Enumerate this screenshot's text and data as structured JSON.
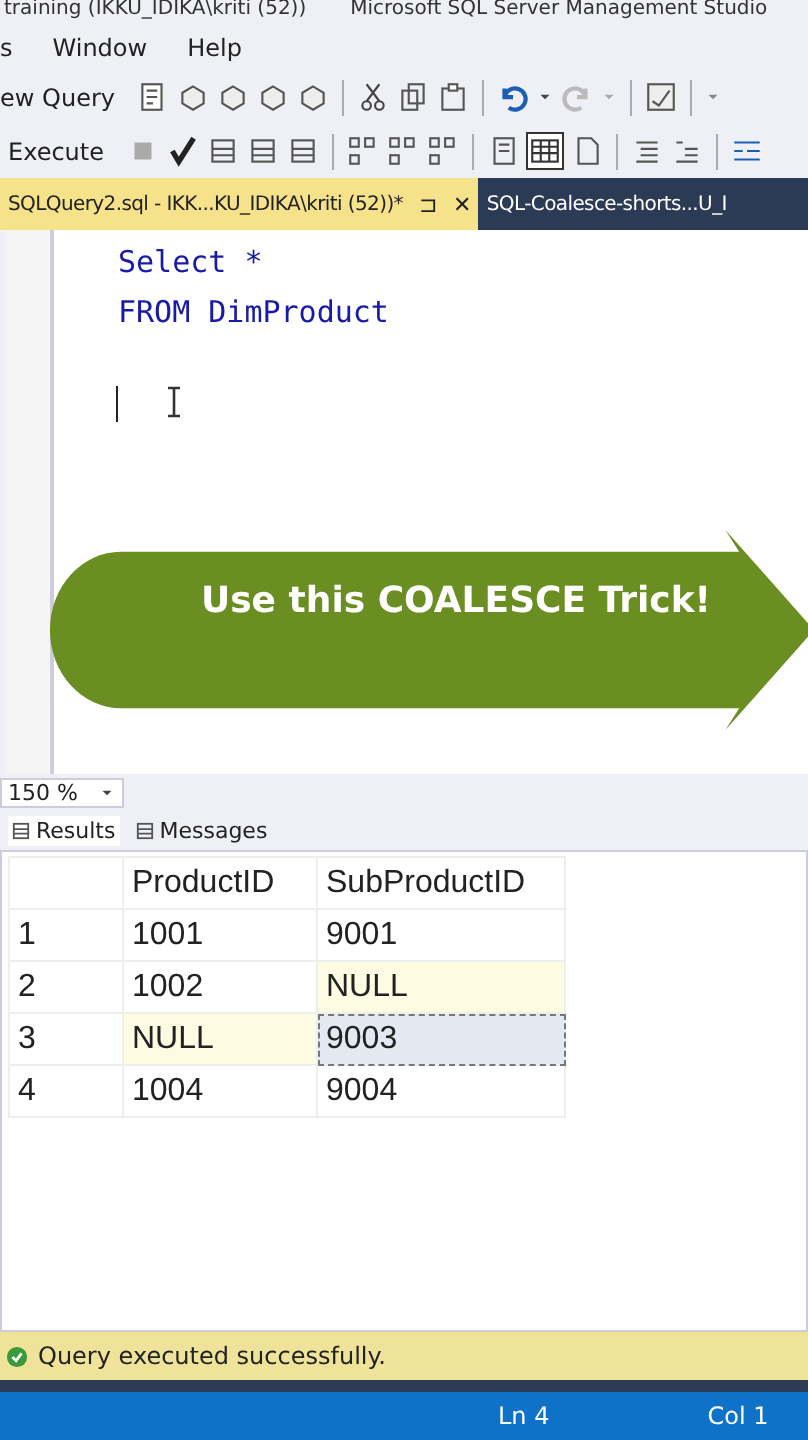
{
  "window": {
    "title": "training (IKKU_IDIKA\\kriti (52))",
    "app": "Microsoft SQL Server Management Studio"
  },
  "menu": [
    "s",
    "Window",
    "Help"
  ],
  "toolbar": {
    "new_query": "ew Query",
    "execute": "Execute"
  },
  "tabs": [
    {
      "label": "SQLQuery2.sql - IKK...KU_IDIKA\\kriti (52))*",
      "selected": true,
      "pin": "⊐",
      "close": "✕"
    },
    {
      "label": "SQL-Coalesce-shorts...U_I",
      "selected": false
    }
  ],
  "editor": {
    "lines": [
      "Select *",
      "FROM DimProduct"
    ]
  },
  "banner": {
    "text": "Use this COALESCE Trick!"
  },
  "zoom": "150 %",
  "result_tabs": [
    {
      "label": "Results",
      "selected": true
    },
    {
      "label": "Messages",
      "selected": false
    }
  ],
  "grid": {
    "columns": [
      "ProductID",
      "SubProductID"
    ],
    "rows": [
      {
        "num": "1",
        "cells": [
          {
            "text": "1001",
            "null": false,
            "selected": false
          },
          {
            "text": "9001",
            "null": false,
            "selected": false
          }
        ]
      },
      {
        "num": "2",
        "cells": [
          {
            "text": "1002",
            "null": false,
            "selected": false
          },
          {
            "text": "NULL",
            "null": true,
            "selected": false
          }
        ]
      },
      {
        "num": "3",
        "cells": [
          {
            "text": "NULL",
            "null": true,
            "selected": false
          },
          {
            "text": "9003",
            "null": false,
            "selected": true
          }
        ]
      },
      {
        "num": "4",
        "cells": [
          {
            "text": "1004",
            "null": false,
            "selected": false
          },
          {
            "text": "9004",
            "null": false,
            "selected": false
          }
        ]
      }
    ]
  },
  "status": {
    "message": "Query executed successfully.",
    "ln": "Ln 4",
    "col": "Col 1"
  }
}
